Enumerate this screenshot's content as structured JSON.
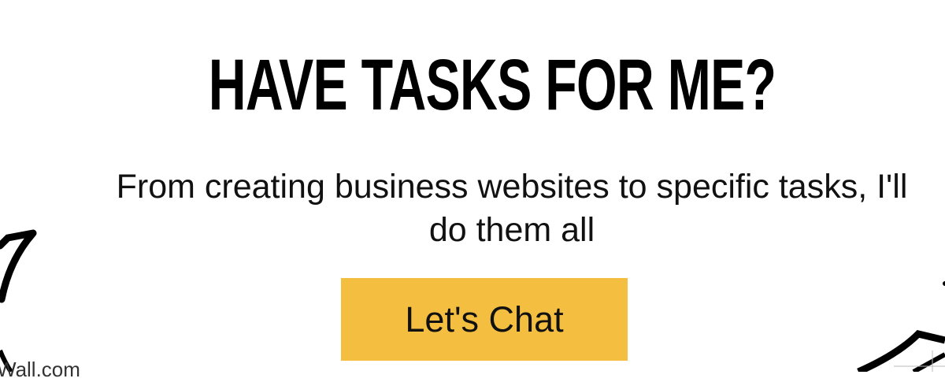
{
  "heading": "HAVE TASKS FOR ME?",
  "subtext": "From creating business websites to specific tasks, I'll do them all",
  "cta_label": "Let's Chat",
  "credit_text": "Wall.com",
  "colors": {
    "button": "#F4BE41",
    "text": "#000000"
  }
}
